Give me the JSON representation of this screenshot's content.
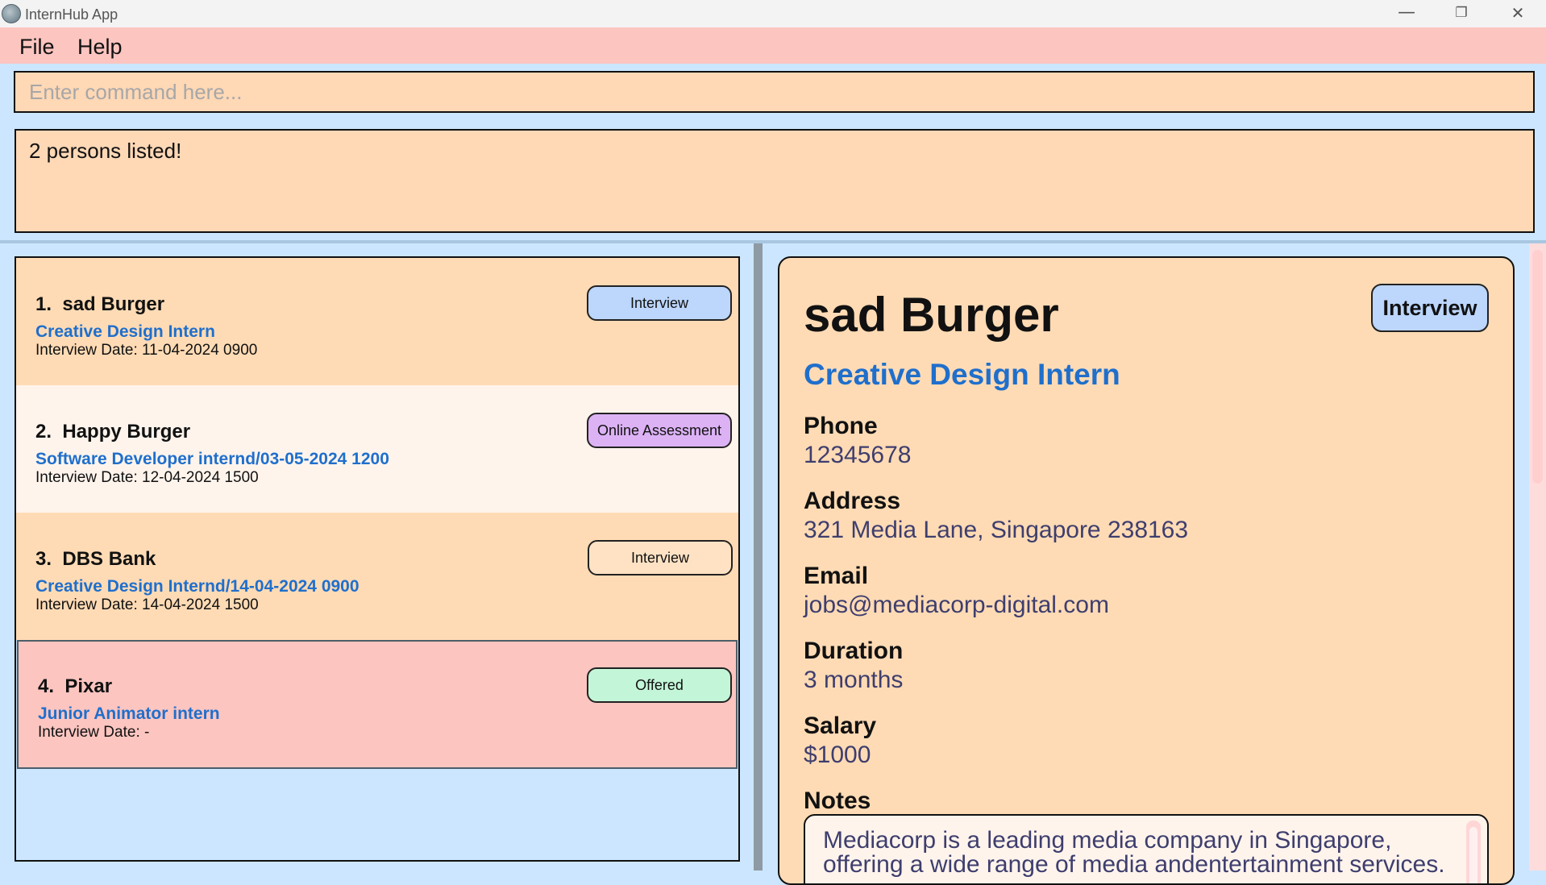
{
  "window": {
    "title": "InternHub App",
    "controls": {
      "minimize": "—",
      "maximize": "❐",
      "close": "✕"
    }
  },
  "menu": {
    "file": "File",
    "help": "Help"
  },
  "command": {
    "placeholder": "Enter command here...",
    "value": ""
  },
  "result": {
    "text": "2 persons listed!"
  },
  "list": {
    "items": [
      {
        "index": "1.",
        "name": "sad Burger",
        "role": "Creative Design Intern",
        "date": "Interview Date: 11-04-2024 0900",
        "status": "Interview",
        "status_color": "#bcd6fc"
      },
      {
        "index": "2.",
        "name": "Happy Burger",
        "role": "Software Developer internd/03-05-2024 1200",
        "date": "Interview Date: 12-04-2024 1500",
        "status": "Online Assessment",
        "status_color": "#dcb2f5"
      },
      {
        "index": "3.",
        "name": "DBS Bank",
        "role": "Creative Design Internd/14-04-2024 0900",
        "date": "Interview Date: 14-04-2024 1500",
        "status": "Interview",
        "status_color": "#ffe2c4"
      },
      {
        "index": "4.",
        "name": "Pixar",
        "role": "Junior Animator intern",
        "date": "Interview Date: -",
        "status": "Offered",
        "status_color": "#c3f6d8",
        "selected": true
      }
    ]
  },
  "detail": {
    "name": "sad Burger",
    "status": "Interview",
    "role": "Creative Design Intern",
    "fields": [
      {
        "label": "Phone",
        "value": "12345678"
      },
      {
        "label": "Address",
        "value": "321 Media Lane, Singapore 238163"
      },
      {
        "label": "Email",
        "value": "jobs@mediacorp-digital.com"
      },
      {
        "label": "Duration",
        "value": "3 months"
      },
      {
        "label": "Salary",
        "value": "$1000"
      }
    ],
    "notes_label": "Notes",
    "notes": "Mediacorp is a leading media company in Singapore, offering a wide range of media andentertainment services."
  },
  "colors": {
    "background": "#cce6ff",
    "menubar": "#fcc5c0",
    "card_peach": "#ffdbb5",
    "card_light": "#fff4ec",
    "card_selected": "#fcc5c0",
    "role_blue": "#1f6fcc",
    "value_text": "#3e3e6e"
  }
}
